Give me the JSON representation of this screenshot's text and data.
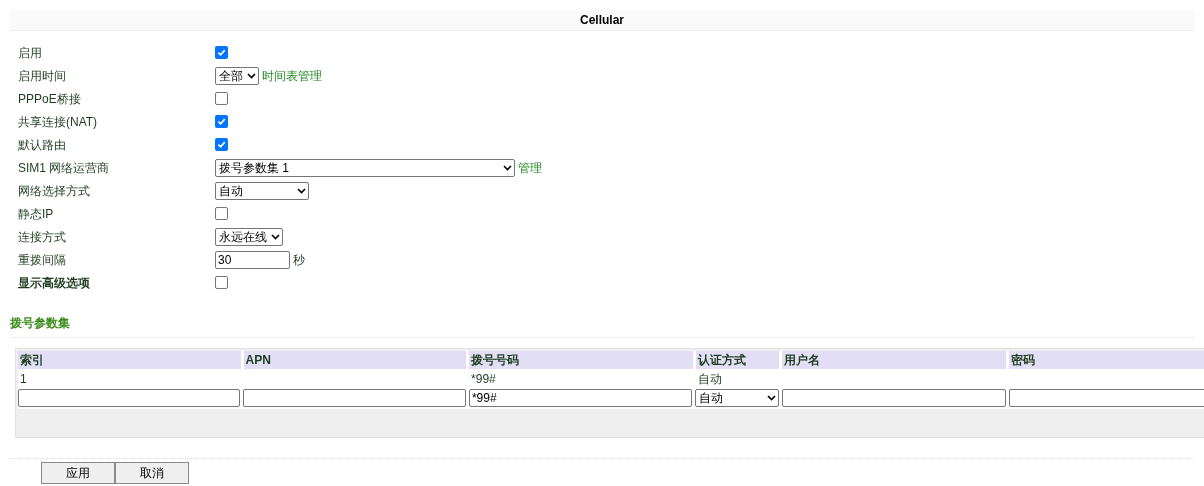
{
  "title": "Cellular",
  "settings": [
    {
      "kind": "checkbox",
      "label": "启用",
      "checked": true
    },
    {
      "kind": "select",
      "label": "启用时间",
      "value": "全部",
      "link": "时间表管理"
    },
    {
      "kind": "checkbox",
      "label": "PPPoE桥接",
      "checked": false
    },
    {
      "kind": "checkbox",
      "label": "共享连接(NAT)",
      "checked": true
    },
    {
      "kind": "checkbox",
      "label": "默认路由",
      "checked": true
    },
    {
      "kind": "select",
      "label": "SIM1 网络运营商",
      "value": "拨号参数集 1",
      "link": "管理"
    },
    {
      "kind": "select",
      "label": "网络选择方式",
      "value": "自动"
    },
    {
      "kind": "checkbox",
      "label": "静态IP",
      "checked": false
    },
    {
      "kind": "select",
      "label": "连接方式",
      "value": "永远在线"
    },
    {
      "kind": "text",
      "label": "重拨间隔",
      "value": "30",
      "unit": "秒"
    },
    {
      "kind": "checkbox",
      "label": "显示高级选项",
      "checked": false,
      "bold": true
    }
  ],
  "dial_profiles": {
    "title": "拨号参数集",
    "columns": [
      "索引",
      "APN",
      "拨号号码",
      "认证方式",
      "用户名",
      "密码"
    ],
    "rows": [
      [
        "1",
        "",
        "*99#",
        "自动",
        "",
        ""
      ]
    ],
    "inputs": [
      {
        "kind": "text"
      },
      {
        "kind": "text"
      },
      {
        "kind": "text",
        "value": "*99#"
      },
      {
        "kind": "select",
        "value": "自动"
      },
      {
        "kind": "text"
      },
      {
        "kind": "text"
      }
    ]
  },
  "buttons": [
    "应用",
    "取消"
  ]
}
